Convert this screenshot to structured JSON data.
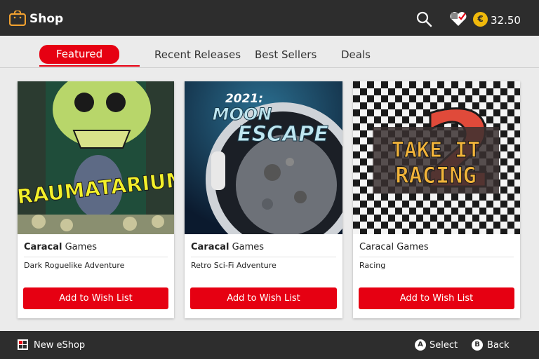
{
  "header": {
    "title": "Shop",
    "balance": "32.50",
    "currency_symbol": "€",
    "accent_color": "#e60012"
  },
  "tabs": [
    {
      "label": "Featured",
      "active": true
    },
    {
      "label": "Recent Releases",
      "active": false
    },
    {
      "label": "Best Sellers",
      "active": false
    },
    {
      "label": "Deals",
      "active": false
    }
  ],
  "cards": [
    {
      "art_title": "TRAUMATARIUM",
      "publisher_bold": "Caracal",
      "publisher_rest": " Games",
      "genre": "Dark Roguelike Adventure",
      "button_label": "Add to Wish List"
    },
    {
      "art_title_line1": "2021:",
      "art_title_line2": "MOON",
      "art_title_line3": "ESCAPE",
      "publisher_bold": "Caracal",
      "publisher_rest": " Games",
      "genre": "Retro Sci-Fi Adventure",
      "button_label": "Add to Wish List"
    },
    {
      "art_title_line1": "TAKE IT",
      "art_title_line2": "RACING",
      "art_badge": "2",
      "publisher_bold": "Caracal",
      "publisher_rest": " Games",
      "genre": "Racing",
      "button_label": "Add to Wish List"
    }
  ],
  "footer": {
    "new_eshop_label": "New eShop",
    "select_key": "A",
    "select_label": "Select",
    "back_key": "B",
    "back_label": "Back"
  },
  "icons": {
    "shop": "shopping-bag-icon",
    "search": "search-icon",
    "wishlist": "heart-check-icon",
    "coin": "euro-coin-icon",
    "eshop": "eshop-grid-icon"
  }
}
